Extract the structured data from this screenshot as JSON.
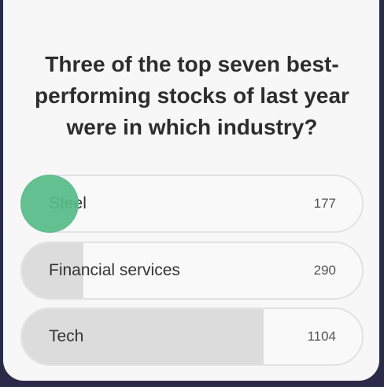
{
  "poll": {
    "question": "Three of the top seven best-performing stocks of last year were in which industry?",
    "options": [
      {
        "label": "Steel",
        "count": "177",
        "fill": 0.0
      },
      {
        "label": "Financial services",
        "count": "290",
        "fill": 0.18
      },
      {
        "label": "Tech",
        "count": "1104",
        "fill": 0.71
      }
    ]
  },
  "colors": {
    "background": "#2c2a49",
    "card": "#f7f7f7",
    "option_fill": "#dcdcdc",
    "marker": "#55bb88"
  }
}
